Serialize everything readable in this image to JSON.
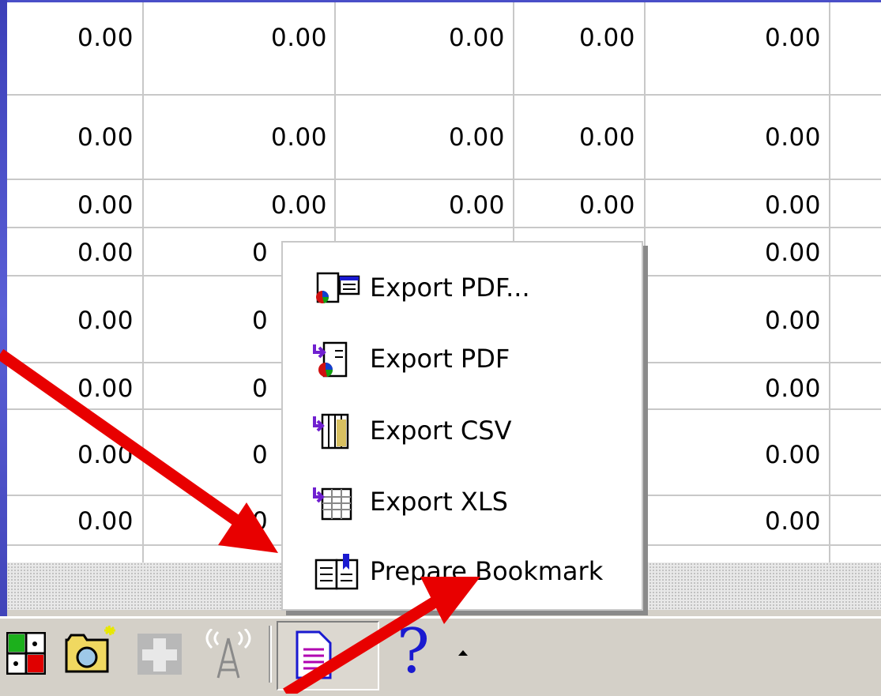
{
  "grid": {
    "rows": [
      [
        "0.00",
        "0.00",
        "0.00",
        "0.00",
        "0.00"
      ],
      [
        "0.00",
        "0.00",
        "0.00",
        "0.00",
        "0.00"
      ],
      [
        "0.00",
        "0.00",
        "0.00",
        "0.00",
        "0.00"
      ],
      [
        "0.00",
        "0",
        "",
        "",
        "0.00"
      ],
      [
        "0.00",
        "0",
        "",
        "",
        "0.00"
      ],
      [
        "0.00",
        "0",
        "",
        "",
        "0.00"
      ],
      [
        "0.00",
        "0",
        "",
        "",
        "0.00"
      ],
      [
        "0.00",
        "0",
        "",
        "",
        "0.00"
      ]
    ]
  },
  "menu": {
    "items": [
      {
        "label": "Export PDF...",
        "icon": "export-pdf-dialog-icon"
      },
      {
        "label": "Export PDF",
        "icon": "export-pdf-icon"
      },
      {
        "label": "Export CSV",
        "icon": "export-csv-icon"
      },
      {
        "label": "Export XLS",
        "icon": "export-xls-icon"
      },
      {
        "label": "Prepare Bookmark",
        "icon": "bookmark-book-icon"
      }
    ]
  },
  "toolbar": {
    "icons": [
      "grid-layout-icon",
      "open-folder-icon",
      "add-icon-disabled",
      "antenna-icon-disabled",
      "export-document-icon",
      "help-icon"
    ],
    "help_label": "?"
  },
  "colors": {
    "annotation_arrow": "#e80000",
    "slide_edge": "#4a4fc8",
    "toolbar_bg": "#d4d0c8",
    "help_blue": "#1a1ad0"
  }
}
